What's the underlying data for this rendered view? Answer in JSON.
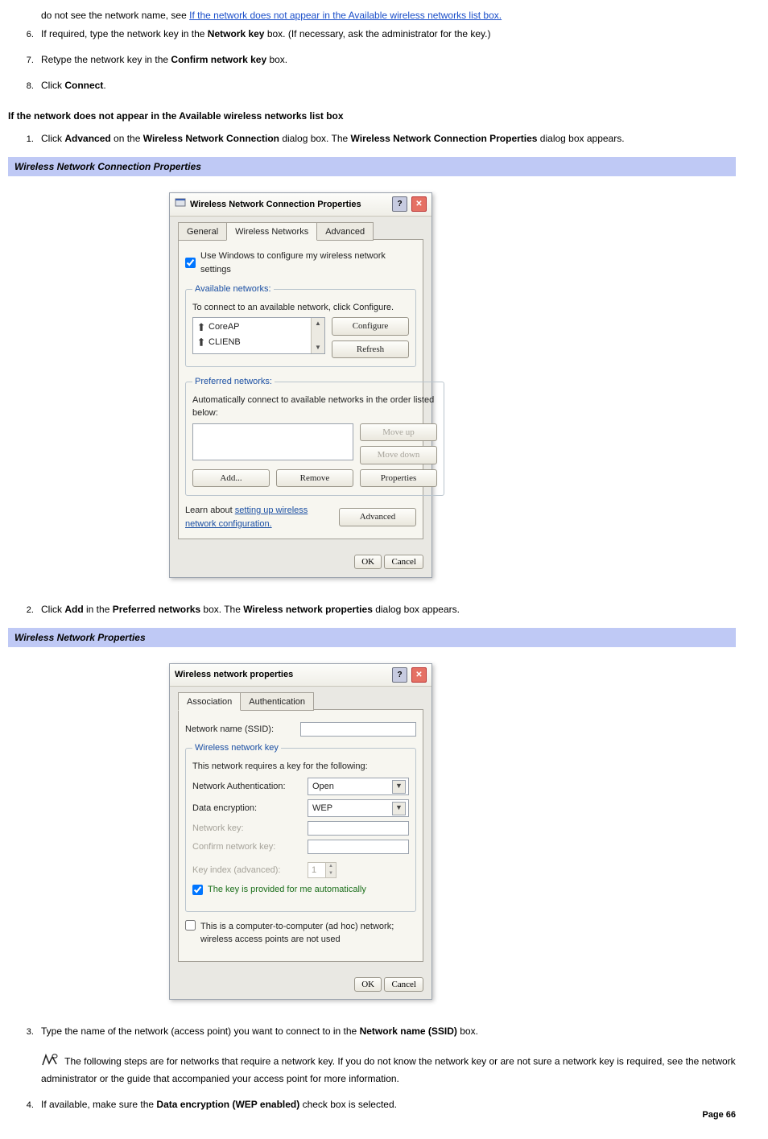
{
  "intro": {
    "line_pre": "do not see the network name, see ",
    "line_link": "If the network does not appear in the Available wireless networks list box."
  },
  "steps_a": {
    "s6_a": "If required, type the network key in the ",
    "s6_b": "Network key",
    "s6_c": " box. (If necessary, ask the administrator for the key.)",
    "s7_a": "Retype the network key in the ",
    "s7_b": "Confirm network key",
    "s7_c": " box.",
    "s8_a": "Click ",
    "s8_b": "Connect",
    "s8_c": "."
  },
  "heading1": "If the network does not appear in the Available wireless networks list box",
  "steps_b": {
    "s1_a": "Click ",
    "s1_b": "Advanced",
    "s1_c": " on the ",
    "s1_d": "Wireless Network Connection",
    "s1_e": " dialog box. The ",
    "s1_f": "Wireless Network Connection Properties",
    "s1_g": " dialog box appears."
  },
  "caption1": "Wireless Network Connection Properties",
  "dialog1": {
    "title": "Wireless Network Connection Properties",
    "tabs": {
      "general": "General",
      "wireless": "Wireless Networks",
      "advanced": "Advanced"
    },
    "use_windows": "Use Windows to configure my wireless network settings",
    "available_legend": "Available networks:",
    "available_desc": "To connect to an available network, click Configure.",
    "available_items": [
      "CoreAP",
      "CLIENB"
    ],
    "btn_configure": "Configure",
    "btn_refresh": "Refresh",
    "preferred_legend": "Preferred networks:",
    "preferred_desc": "Automatically connect to available networks in the order listed below:",
    "btn_moveup": "Move up",
    "btn_movedown": "Move down",
    "btn_add": "Add...",
    "btn_remove": "Remove",
    "btn_properties": "Properties",
    "learn_pre": "Learn about ",
    "learn_link": "setting up wireless network configuration.",
    "btn_advanced": "Advanced",
    "btn_ok": "OK",
    "btn_cancel": "Cancel"
  },
  "steps_c": {
    "s2_a": "Click ",
    "s2_b": "Add",
    "s2_c": " in the ",
    "s2_d": "Preferred networks",
    "s2_e": " box. The ",
    "s2_f": "Wireless network properties",
    "s2_g": " dialog box appears."
  },
  "caption2": "Wireless Network Properties",
  "dialog2": {
    "title": "Wireless network properties",
    "tabs": {
      "assoc": "Association",
      "auth": "Authentication"
    },
    "ssid_label": "Network name (SSID):",
    "group_legend": "Wireless network key",
    "group_desc": "This network requires a key for the following:",
    "auth_label": "Network Authentication:",
    "auth_value": "Open",
    "enc_label": "Data encryption:",
    "enc_value": "WEP",
    "netkey_label": "Network key:",
    "confkey_label": "Confirm network key:",
    "keyidx_label": "Key index (advanced):",
    "keyidx_value": "1",
    "auto_key": "The key is provided for me automatically",
    "adhoc": "This is a computer-to-computer (ad hoc) network; wireless access points are not used",
    "btn_ok": "OK",
    "btn_cancel": "Cancel"
  },
  "steps_d": {
    "s3_a": "Type the name of the network (access point) you want to connect to in the ",
    "s3_b": "Network name (SSID)",
    "s3_c": " box.",
    "note": "The following steps are for networks that require a network key. If you do not know the network key or are not sure a network key is required, see the network administrator or the guide that accompanied your access point for more information.",
    "s4_a": "If available, make sure the ",
    "s4_b": "Data encryption (WEP enabled)",
    "s4_c": " check box is selected."
  },
  "page": "Page 66"
}
